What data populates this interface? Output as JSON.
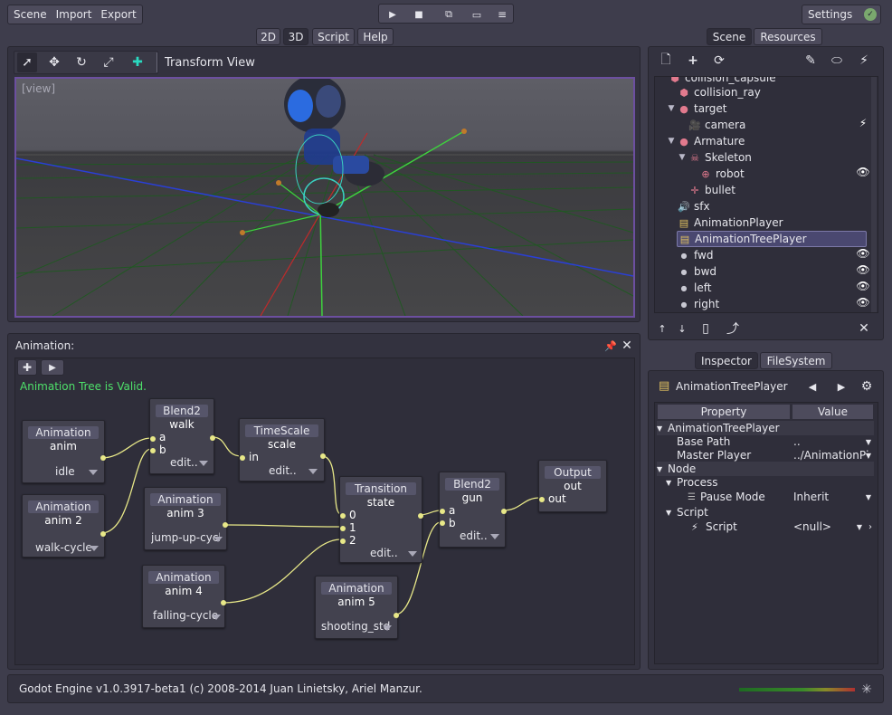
{
  "menu": {
    "scene": "Scene",
    "import": "Import",
    "export": "Export"
  },
  "play": {
    "icons": [
      "play-icon",
      "stop-icon",
      "step-icon",
      "folder-icon",
      "list-icon"
    ]
  },
  "settings": {
    "label": "Settings",
    "status": "✓"
  },
  "mode_tabs": [
    {
      "label": "2D"
    },
    {
      "label": "3D"
    },
    {
      "label": "Script"
    },
    {
      "label": "Help"
    }
  ],
  "viewport": {
    "transform": "Transform",
    "view": "View",
    "label": "[view]"
  },
  "scene_tabs": {
    "scene": "Scene",
    "resources": "Resources"
  },
  "tree": {
    "items": [
      {
        "label": "collision_capsule"
      },
      {
        "label": "collision_ray"
      },
      {
        "label": "target"
      },
      {
        "label": "camera"
      },
      {
        "label": "Armature"
      },
      {
        "label": "Skeleton"
      },
      {
        "label": "robot"
      },
      {
        "label": "bullet"
      },
      {
        "label": "sfx"
      },
      {
        "label": "AnimationPlayer"
      },
      {
        "label": "AnimationTreePlayer"
      },
      {
        "label": "fwd"
      },
      {
        "label": "bwd"
      },
      {
        "label": "left"
      },
      {
        "label": "right"
      }
    ]
  },
  "animation": {
    "title": "Animation:",
    "status": "Animation Tree is Valid.",
    "nodes": {
      "anim": {
        "type": "Animation",
        "name": "anim",
        "value": "idle"
      },
      "anim2": {
        "type": "Animation",
        "name": "anim 2",
        "value": "walk-cycle"
      },
      "walk": {
        "type": "Blend2",
        "name": "walk",
        "a": "a",
        "b": "b",
        "edit": "edit.."
      },
      "scale": {
        "type": "TimeScale",
        "name": "scale",
        "in": "in",
        "edit": "edit.."
      },
      "anim3": {
        "type": "Animation",
        "name": "anim 3",
        "value": "jump-up-cycle"
      },
      "anim4": {
        "type": "Animation",
        "name": "anim 4",
        "value": "falling-cycle"
      },
      "state": {
        "type": "Transition",
        "name": "state",
        "p0": "0",
        "p1": "1",
        "p2": "2",
        "edit": "edit.."
      },
      "anim5": {
        "type": "Animation",
        "name": "anim 5",
        "value": "shooting_std"
      },
      "gun": {
        "type": "Blend2",
        "name": "gun",
        "a": "a",
        "b": "b",
        "edit": "edit.."
      },
      "out": {
        "type": "Output",
        "name": "out",
        "port": "out"
      }
    }
  },
  "inspector_tabs": {
    "inspector": "Inspector",
    "filesystem": "FileSystem"
  },
  "inspector": {
    "object": "AnimationTreePlayer",
    "col_property": "Property",
    "col_value": "Value",
    "rows": [
      {
        "label": "AnimationTreePlayer",
        "value": ""
      },
      {
        "label": "Base Path",
        "value": ".."
      },
      {
        "label": "Master Player",
        "value": "../AnimationPl"
      },
      {
        "label": "Node",
        "value": ""
      },
      {
        "label": "Process",
        "value": ""
      },
      {
        "label": "Pause Mode",
        "value": "Inherit"
      },
      {
        "label": "Script",
        "value": ""
      },
      {
        "label": "Script",
        "value": "<null>"
      }
    ]
  },
  "status_bar": {
    "text": "Godot Engine v1.0.3917-beta1 (c) 2008-2014 Juan Linietsky, Ariel Manzur."
  },
  "colors": {
    "accent_green": "#4ee06a",
    "wire": "#e8e888",
    "panel": "#33323f",
    "bg": "#3e3d4c"
  }
}
